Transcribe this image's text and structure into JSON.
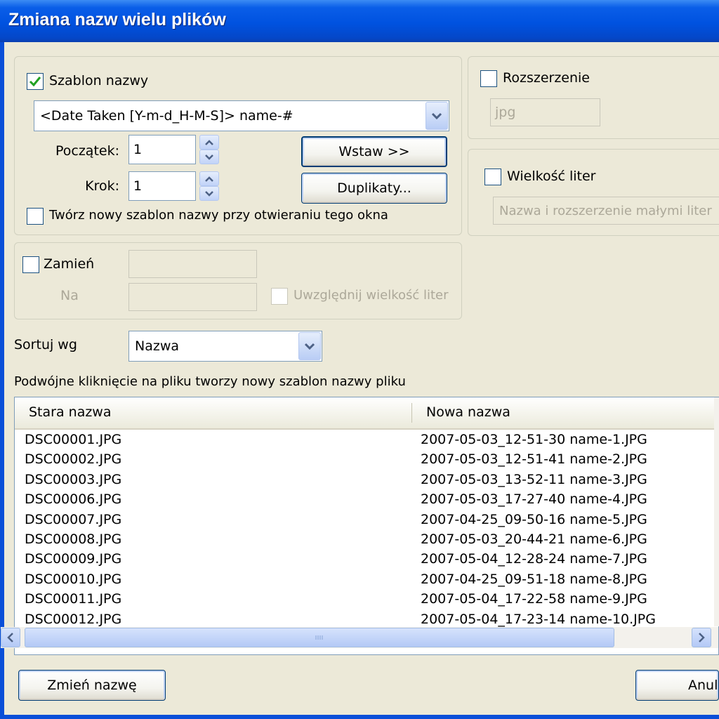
{
  "window": {
    "title": "Zmiana nazw wielu plików"
  },
  "name_template": {
    "label": "Szablon nazwy",
    "checked": true,
    "value": "<Date Taken [Y-m-d_H-M-S]> name-#",
    "start_label": "Początek:",
    "start_value": "1",
    "step_label": "Krok:",
    "step_value": "1",
    "insert_button": "Wstaw >>",
    "duplicates_button": "Duplikaty...",
    "new_template_label": "Twórz nowy szablon nazwy przy otwieraniu tego okna"
  },
  "extension": {
    "label": "Rozszerzenie",
    "value": "jpg"
  },
  "case": {
    "label": "Wielkość liter",
    "value": "Nazwa i rozszerzenie małymi liter"
  },
  "replace": {
    "label": "Zamień",
    "with_label": "Na",
    "case_label": "Uwzględnij wielkość liter"
  },
  "sort": {
    "label": "Sortuj wg",
    "value": "Nazwa"
  },
  "hint": "Podwójne kliknięcie na pliku tworzy nowy szablon nazwy pliku",
  "list": {
    "columns": [
      "Stara nazwa",
      "Nowa nazwa"
    ],
    "rows": [
      [
        "DSC00001.JPG",
        "2007-05-03_12-51-30 name-1.JPG"
      ],
      [
        "DSC00002.JPG",
        "2007-05-03_12-51-41 name-2.JPG"
      ],
      [
        "DSC00003.JPG",
        "2007-05-03_13-52-11 name-3.JPG"
      ],
      [
        "DSC00006.JPG",
        "2007-05-03_17-27-40 name-4.JPG"
      ],
      [
        "DSC00007.JPG",
        "2007-04-25_09-50-16 name-5.JPG"
      ],
      [
        "DSC00008.JPG",
        "2007-05-03_20-44-21 name-6.JPG"
      ],
      [
        "DSC00009.JPG",
        "2007-05-04_12-28-24 name-7.JPG"
      ],
      [
        "DSC00010.JPG",
        "2007-04-25_09-51-18 name-8.JPG"
      ],
      [
        "DSC00011.JPG",
        "2007-05-04_17-22-58 name-9.JPG"
      ],
      [
        "DSC00012.JPG",
        "2007-05-04_17-23-14 name-10.JPG"
      ]
    ]
  },
  "buttons": {
    "rename": "Zmień nazwę",
    "cancel": "Anuluj"
  }
}
